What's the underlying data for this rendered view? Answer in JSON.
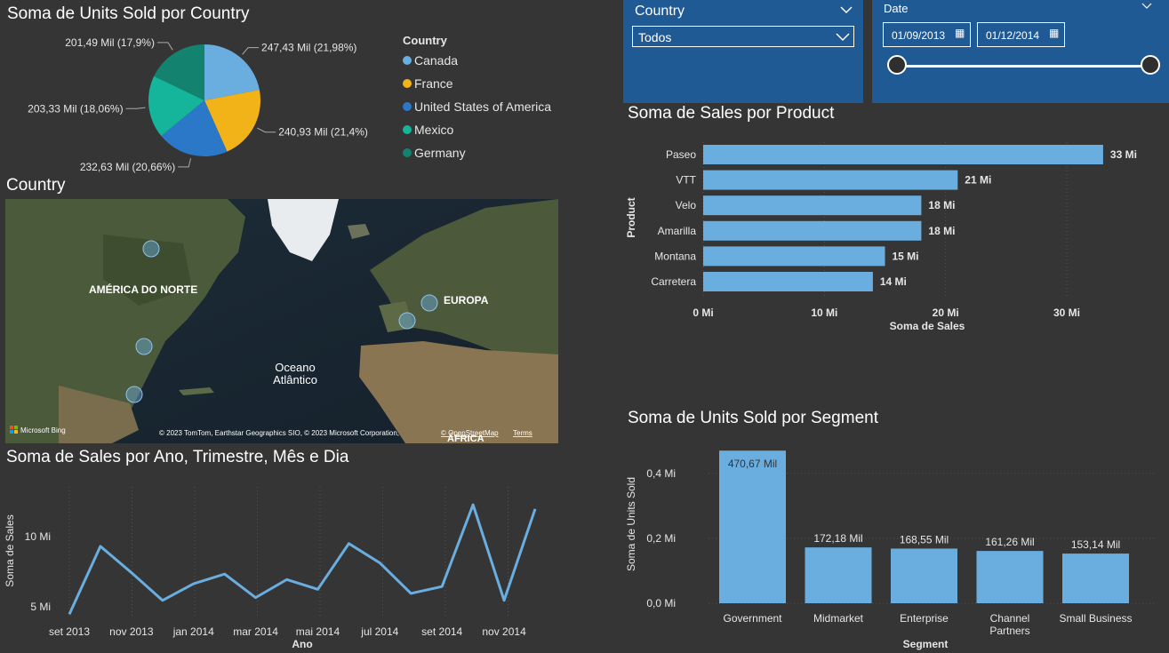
{
  "pie": {
    "title": "Soma de Units Sold por Country",
    "legend_title": "Country",
    "slices": [
      {
        "name": "Canada",
        "label": "247,43 Mil (21,98%)",
        "value": 247.43,
        "color": "#6aaee0"
      },
      {
        "name": "France",
        "label": "240,93 Mil (21,4%)",
        "value": 240.93,
        "color": "#f2b318"
      },
      {
        "name": "United States of America",
        "label": "232,63 Mil (20,66%)",
        "value": 232.63,
        "color": "#2c78c8"
      },
      {
        "name": "Mexico",
        "label": "203,33 Mil (18,06%)",
        "value": 203.33,
        "color": "#14b59a"
      },
      {
        "name": "Germany",
        "label": "201,49 Mil (17,9%)",
        "value": 201.49,
        "color": "#13836f"
      }
    ]
  },
  "map": {
    "title": "Country",
    "label_na": "AMÉRICA DO NORTE",
    "label_eu": "EUROPA",
    "label_ocean1": "Oceano",
    "label_ocean2": "Atlântico",
    "label_af": "ÁFRICA",
    "logo": "Microsoft Bing",
    "copyright": "© 2023 TomTom, Earthstar Geographics SIO, © 2023 Microsoft Corporation,",
    "osm": "© OpenStreetMap",
    "terms": "Terms"
  },
  "line": {
    "title": "Soma de Sales por Ano, Trimestre, Mês e Dia",
    "ylabel": "Soma de Sales",
    "xlabel": "Ano",
    "yticks": [
      "5 Mi",
      "10 Mi"
    ]
  },
  "slicer_country": {
    "title": "Country",
    "value": "Todos"
  },
  "slicer_date": {
    "title": "Date",
    "start": "01/09/2013",
    "end": "01/12/2014"
  },
  "product": {
    "title": "Soma de Sales por Product"
  },
  "segment": {
    "title": "Soma de Units Sold por Segment"
  },
  "chart_data": [
    {
      "type": "pie",
      "title": "Soma de Units Sold por Country",
      "categories": [
        "Canada",
        "France",
        "United States of America",
        "Mexico",
        "Germany"
      ],
      "values": [
        247.43,
        240.93,
        232.63,
        203.33,
        201.49
      ],
      "unit": "Mil",
      "legend": "right"
    },
    {
      "type": "bar",
      "orientation": "horizontal",
      "title": "Soma de Sales por Product",
      "categories": [
        "Paseo",
        "VTT",
        "Velo",
        "Amarilla",
        "Montana",
        "Carretera"
      ],
      "values": [
        33,
        21,
        18,
        18,
        15,
        14
      ],
      "value_labels": [
        "33 Mi",
        "21 Mi",
        "18 Mi",
        "18 Mi",
        "15 Mi",
        "14 Mi"
      ],
      "xlabel": "Soma de Sales",
      "ylabel": "Product",
      "xlim": [
        0,
        35
      ],
      "xticks": [
        "0 Mi",
        "10 Mi",
        "20 Mi",
        "30 Mi"
      ],
      "color": "#6aaee0"
    },
    {
      "type": "line",
      "title": "Soma de Sales por Ano, Trimestre, Mês e Dia",
      "x": [
        "2013-09",
        "2013-10",
        "2013-11",
        "2013-12",
        "2014-01",
        "2014-02",
        "2014-03",
        "2014-04",
        "2014-05",
        "2014-06",
        "2014-07",
        "2014-08",
        "2014-09",
        "2014-10",
        "2014-11",
        "2014-12"
      ],
      "values": [
        4.4,
        9.3,
        7.4,
        5.4,
        6.6,
        7.3,
        5.6,
        6.9,
        6.2,
        9.5,
        8.1,
        5.9,
        6.4,
        12.3,
        5.4,
        12.0
      ],
      "xticks": [
        "set 2013",
        "nov 2013",
        "jan 2014",
        "mar 2014",
        "mai 2014",
        "jul 2014",
        "set 2014",
        "nov 2014"
      ],
      "xlabel": "Ano",
      "ylabel": "Soma de Sales",
      "ylim": [
        4,
        13
      ],
      "color": "#6aaee0"
    },
    {
      "type": "bar",
      "orientation": "vertical",
      "title": "Soma de Units Sold por Segment",
      "categories": [
        "Government",
        "Midmarket",
        "Enterprise",
        "Channel Partners",
        "Small Business"
      ],
      "values": [
        470.67,
        172.18,
        168.55,
        161.26,
        153.14
      ],
      "value_labels": [
        "470,67 Mil",
        "172,18 Mil",
        "168,55 Mil",
        "161,26 Mil",
        "153,14 Mil"
      ],
      "xlabel": "Segment",
      "ylabel": "Soma de Units Sold",
      "yticks": [
        "0,0 Mi",
        "0,2 Mi",
        "0,4 Mi"
      ],
      "ylim": [
        0,
        0.48
      ],
      "color": "#6aaee0"
    }
  ]
}
